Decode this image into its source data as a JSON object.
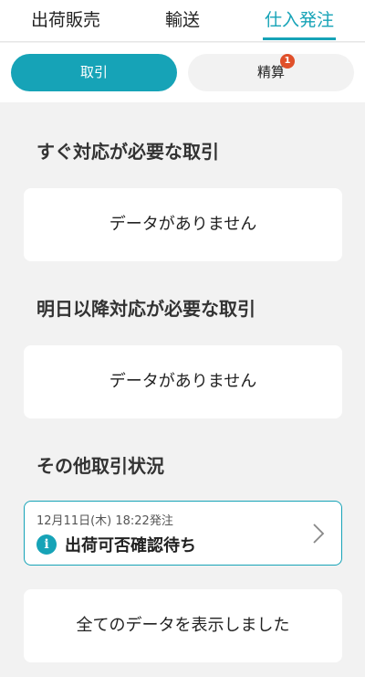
{
  "tabs": [
    {
      "label": "出荷販売"
    },
    {
      "label": "輸送"
    },
    {
      "label": "仕入発注",
      "active": true
    }
  ],
  "segments": [
    {
      "label": "取引",
      "active": true
    },
    {
      "label": "精算",
      "badge": "1"
    }
  ],
  "sections": {
    "urgent": {
      "title": "すぐ対応が必要な取引",
      "empty_text": "データがありません"
    },
    "tomorrow": {
      "title": "明日以降対応が必要な取引",
      "empty_text": "データがありません"
    },
    "others": {
      "title": "その他取引状況",
      "transactions": [
        {
          "date": "12月11日(木) 18:22発注",
          "status": "出荷可否確認待ち",
          "status_icon": "info-icon"
        }
      ]
    }
  },
  "footer": {
    "text": "全てのデータを表示しました"
  },
  "colors": {
    "accent": "#16a3b7",
    "badge": "#e0502a",
    "background": "#f2f2f2"
  }
}
